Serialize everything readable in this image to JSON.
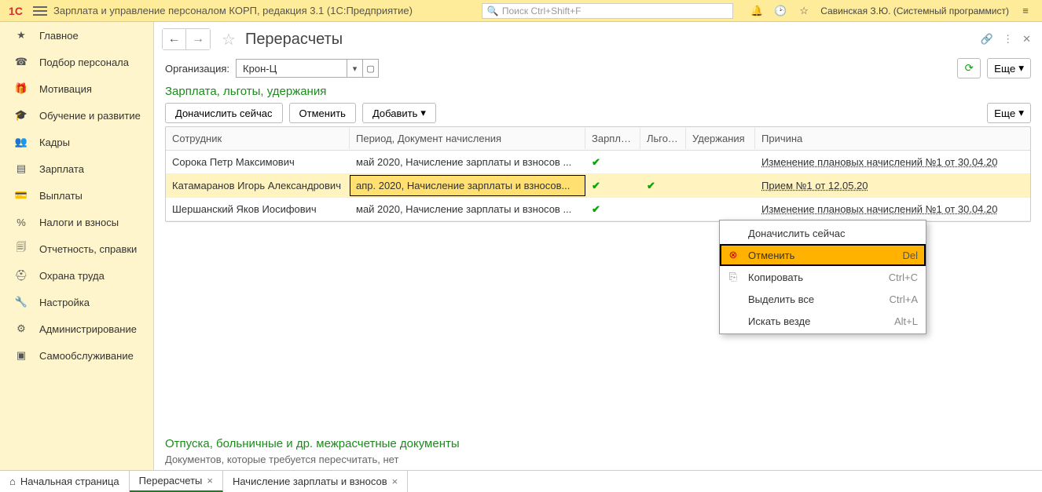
{
  "titlebar": {
    "app_title": "Зарплата и управление персоналом КОРП, редакция 3.1  (1С:Предприятие)",
    "search_placeholder": "Поиск Ctrl+Shift+F",
    "user": "Савинская З.Ю. (Системный программист)"
  },
  "sidebar": {
    "items": [
      {
        "icon": "★",
        "label": "Главное"
      },
      {
        "icon": "☎",
        "label": "Подбор персонала"
      },
      {
        "icon": "🎁",
        "label": "Мотивация"
      },
      {
        "icon": "🎓",
        "label": "Обучение и развитие"
      },
      {
        "icon": "👥",
        "label": "Кадры"
      },
      {
        "icon": "▤",
        "label": "Зарплата"
      },
      {
        "icon": "💳",
        "label": "Выплаты"
      },
      {
        "icon": "%",
        "label": "Налоги и взносы"
      },
      {
        "icon": "🗐",
        "label": "Отчетность, справки"
      },
      {
        "icon": "⛑",
        "label": "Охрана труда"
      },
      {
        "icon": "🔧",
        "label": "Настройка"
      },
      {
        "icon": "⚙",
        "label": "Администрирование"
      },
      {
        "icon": "▣",
        "label": "Самообслуживание"
      }
    ]
  },
  "page": {
    "title": "Перерасчеты",
    "org_label": "Организация:",
    "org_value": "Крон-Ц",
    "more_label": "Еще",
    "section1_title": "Зарплата, льготы, удержания",
    "section2_title": "Отпуска, больничные и др. межрасчетные документы",
    "section2_sub": "Документов, которые требуется пересчитать, нет",
    "toolbar": {
      "accrue": "Доначислить сейчас",
      "cancel": "Отменить",
      "add": "Добавить",
      "more": "Еще"
    },
    "grid": {
      "headers": {
        "employee": "Сотрудник",
        "period": "Период, Документ начисления",
        "salary": "Зарплата",
        "benefits": "Льготы",
        "deductions": "Удержания",
        "reason": "Причина"
      },
      "rows": [
        {
          "employee": "Сорока Петр Максимович",
          "period": "май 2020, Начисление зарплаты и взносов ...",
          "salary": true,
          "benefits": false,
          "deductions": false,
          "reason": "Изменение плановых начислений №1 от 30.04.20"
        },
        {
          "employee": "Катамаранов Игорь Александрович",
          "period": "апр. 2020, Начисление зарплаты и взносов...",
          "salary": true,
          "benefits": true,
          "deductions": false,
          "reason": "Прием №1 от 12.05.20",
          "selected": true
        },
        {
          "employee": "Шершанский Яков Иосифович",
          "period": "май 2020, Начисление зарплаты и взносов ...",
          "salary": true,
          "benefits": false,
          "deductions": false,
          "reason": "Изменение плановых начислений №1 от 30.04.20"
        }
      ]
    }
  },
  "context_menu": {
    "items": [
      {
        "icon": "",
        "label": "Доначислить сейчас",
        "shortcut": ""
      },
      {
        "icon": "⊗",
        "label": "Отменить",
        "shortcut": "Del",
        "highlight": true,
        "red": true
      },
      {
        "icon": "⎘",
        "label": "Копировать",
        "shortcut": "Ctrl+C",
        "gray": true
      },
      {
        "icon": "",
        "label": "Выделить все",
        "shortcut": "Ctrl+A"
      },
      {
        "icon": "",
        "label": "Искать везде",
        "shortcut": "Alt+L"
      }
    ]
  },
  "windowbar": {
    "tabs": [
      {
        "label": "Начальная страница",
        "home": true
      },
      {
        "label": "Перерасчеты",
        "active": true,
        "closable": true
      },
      {
        "label": "Начисление зарплаты и взносов",
        "closable": true
      }
    ]
  }
}
